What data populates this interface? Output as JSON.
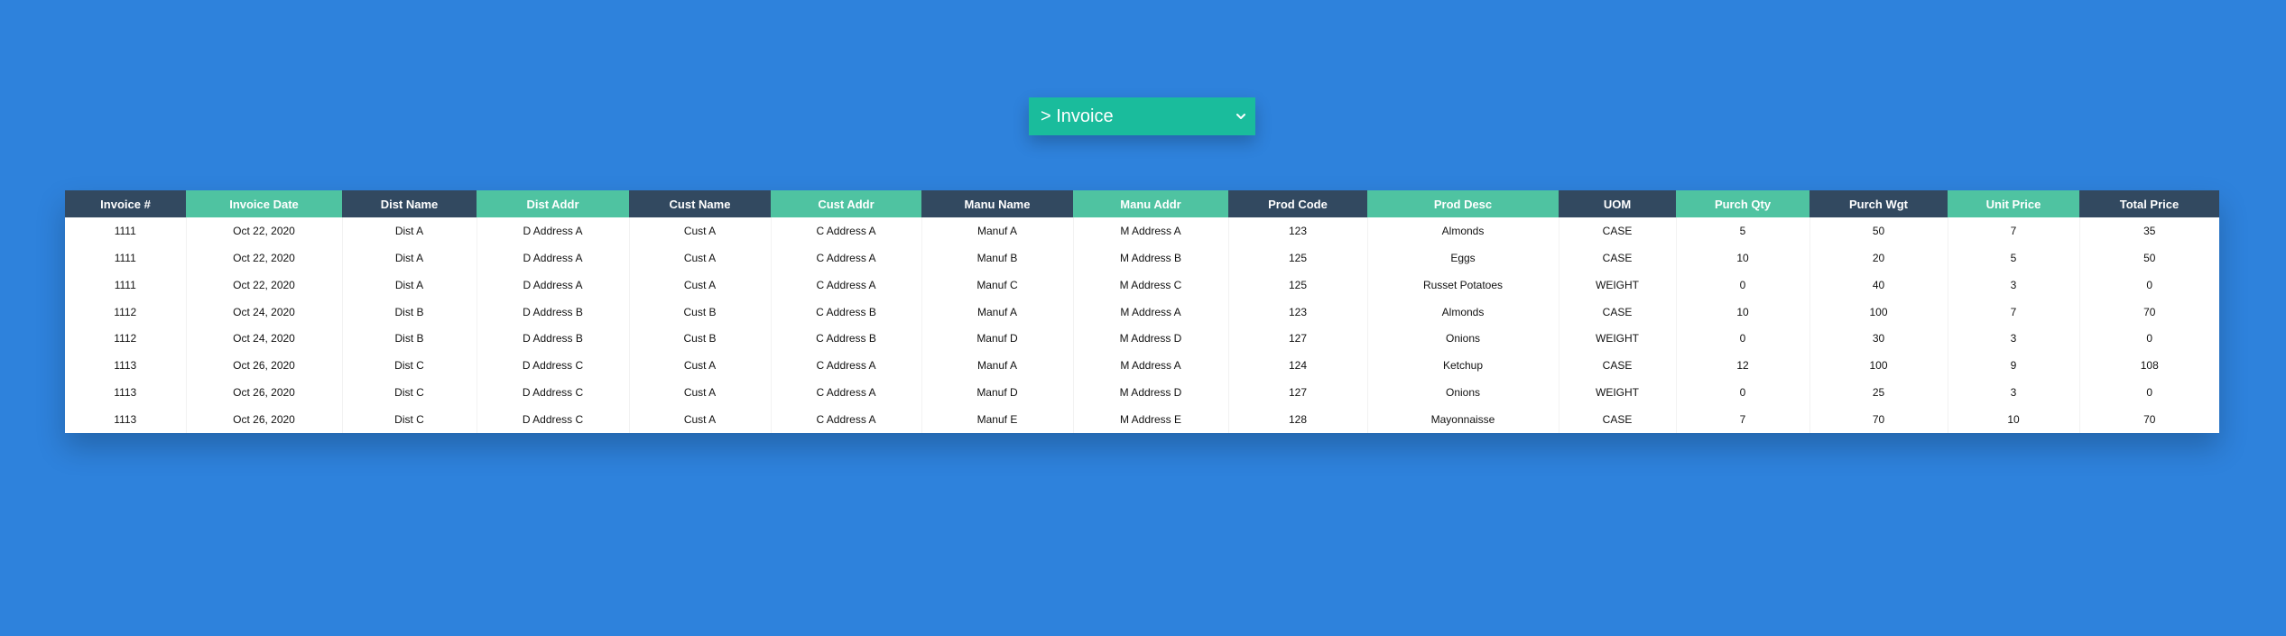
{
  "select": {
    "value": "> Invoice"
  },
  "table": {
    "headers": [
      "Invoice #",
      "Invoice Date",
      "Dist Name",
      "Dist Addr",
      "Cust Name",
      "Cust Addr",
      "Manu Name",
      "Manu Addr",
      "Prod Code",
      "Prod Desc",
      "UOM",
      "Purch Qty",
      "Purch Wgt",
      "Unit Price",
      "Total Price"
    ],
    "rows": [
      [
        "1111",
        "Oct 22, 2020",
        "Dist A",
        "D Address A",
        "Cust A",
        "C Address A",
        "Manuf A",
        "M Address A",
        "123",
        "Almonds",
        "CASE",
        "5",
        "50",
        "7",
        "35"
      ],
      [
        "1111",
        "Oct 22, 2020",
        "Dist A",
        "D Address A",
        "Cust A",
        "C Address A",
        "Manuf B",
        "M Address B",
        "125",
        "Eggs",
        "CASE",
        "10",
        "20",
        "5",
        "50"
      ],
      [
        "1111",
        "Oct 22, 2020",
        "Dist A",
        "D Address A",
        "Cust A",
        "C Address A",
        "Manuf C",
        "M Address C",
        "125",
        "Russet Potatoes",
        "WEIGHT",
        "0",
        "40",
        "3",
        "0"
      ],
      [
        "1112",
        "Oct 24, 2020",
        "Dist B",
        "D Address B",
        "Cust B",
        "C Address B",
        "Manuf A",
        "M Address A",
        "123",
        "Almonds",
        "CASE",
        "10",
        "100",
        "7",
        "70"
      ],
      [
        "1112",
        "Oct 24, 2020",
        "Dist B",
        "D Address B",
        "Cust B",
        "C Address B",
        "Manuf D",
        "M Address D",
        "127",
        "Onions",
        "WEIGHT",
        "0",
        "30",
        "3",
        "0"
      ],
      [
        "1113",
        "Oct 26, 2020",
        "Dist C",
        "D Address C",
        "Cust A",
        "C Address A",
        "Manuf A",
        "M Address A",
        "124",
        "Ketchup",
        "CASE",
        "12",
        "100",
        "9",
        "108"
      ],
      [
        "1113",
        "Oct 26, 2020",
        "Dist C",
        "D Address C",
        "Cust A",
        "C Address A",
        "Manuf D",
        "M Address D",
        "127",
        "Onions",
        "WEIGHT",
        "0",
        "25",
        "3",
        "0"
      ],
      [
        "1113",
        "Oct 26, 2020",
        "Dist C",
        "D Address C",
        "Cust A",
        "C Address A",
        "Manuf E",
        "M Address E",
        "128",
        "Mayonnaisse",
        "CASE",
        "7",
        "70",
        "10",
        "70"
      ]
    ]
  },
  "colors": {
    "page_background": "#2e82dc",
    "select_background": "#1abc9c",
    "header_dark": "#324960",
    "header_teal": "#4fc3a1"
  },
  "icons": {
    "select_chevron": "chevron-down-icon"
  }
}
